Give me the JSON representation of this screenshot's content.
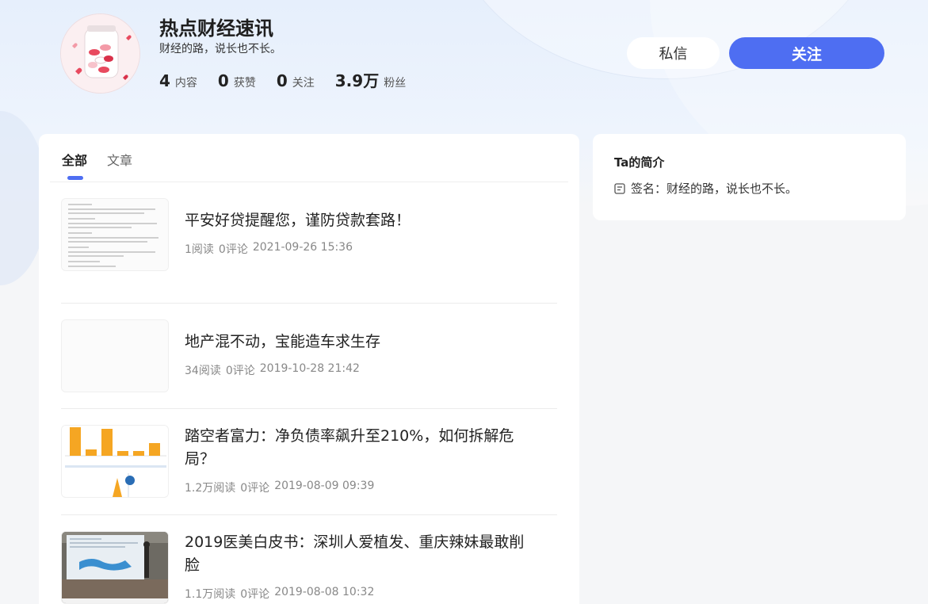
{
  "profile": {
    "name": "热点财经速讯",
    "bio": "财经的路，说长也不长。",
    "stats": [
      {
        "num": "4",
        "label": "内容"
      },
      {
        "num": "0",
        "label": "获赞"
      },
      {
        "num": "0",
        "label": "关注"
      },
      {
        "num": "3.9万",
        "label": "粉丝"
      }
    ]
  },
  "actions": {
    "message_label": "私信",
    "follow_label": "关注"
  },
  "tabs": [
    {
      "label": "全部",
      "active": true
    },
    {
      "label": "文章",
      "active": false
    }
  ],
  "feed": [
    {
      "title": "平安好贷提醒您，谨防贷款套路！",
      "reads": "1阅读",
      "comments": "0评论",
      "time": "2021-09-26 15:36"
    },
    {
      "title": "地产混不动，宝能造车求生存",
      "reads": "34阅读",
      "comments": "0评论",
      "time": "2019-10-28 21:42"
    },
    {
      "title": "踏空者富力：净负债率飙升至210%，如何拆解危局？",
      "reads": "1.2万阅读",
      "comments": "0评论",
      "time": "2019-08-09 09:39"
    },
    {
      "title": "2019医美白皮书：深圳人爱植发、重庆辣妹最敢削脸",
      "reads": "1.1万阅读",
      "comments": "0评论",
      "time": "2019-08-08 10:32"
    }
  ],
  "intro": {
    "title": "Ta的简介",
    "signature": "签名：财经的路，说长也不长。"
  },
  "colors": {
    "accent": "#4e6ef2",
    "bar_orange": "#f5a623"
  },
  "icons": {
    "intro_row": "document-icon"
  }
}
